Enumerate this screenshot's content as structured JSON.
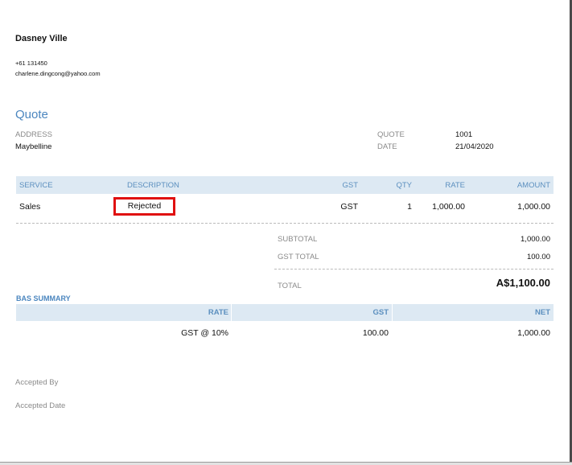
{
  "company": {
    "name": "Dasney Ville",
    "phone": "+61 131450",
    "email": "charlene.dingcong@yahoo.com"
  },
  "document": {
    "title": "Quote"
  },
  "address": {
    "label": "ADDRESS",
    "value": "Maybelline"
  },
  "meta": {
    "quote_label": "QUOTE",
    "quote_value": "1001",
    "date_label": "DATE",
    "date_value": "21/04/2020"
  },
  "items": {
    "headers": {
      "service": "SERVICE",
      "description": "DESCRIPTION",
      "gst": "GST",
      "qty": "QTY",
      "rate": "RATE",
      "amount": "AMOUNT"
    },
    "rows": [
      {
        "service": "Sales",
        "description": "Rejected",
        "gst": "GST",
        "qty": "1",
        "rate": "1,000.00",
        "amount": "1,000.00"
      }
    ]
  },
  "totals": {
    "subtotal_label": "SUBTOTAL",
    "subtotal_value": "1,000.00",
    "gst_total_label": "GST TOTAL",
    "gst_total_value": "100.00",
    "total_label": "TOTAL",
    "total_value": "A$1,100.00"
  },
  "bas_summary": {
    "title": "BAS SUMMARY",
    "headers": {
      "rate": "RATE",
      "gst": "GST",
      "net": "NET"
    },
    "rows": [
      {
        "rate": "GST @ 10%",
        "gst": "100.00",
        "net": "1,000.00"
      }
    ]
  },
  "acceptance": {
    "accepted_by_label": "Accepted By",
    "accepted_date_label": "Accepted Date"
  },
  "colors": {
    "accent": "#4b86bf",
    "header_bg": "#dde9f3",
    "highlight": "#e01010"
  }
}
